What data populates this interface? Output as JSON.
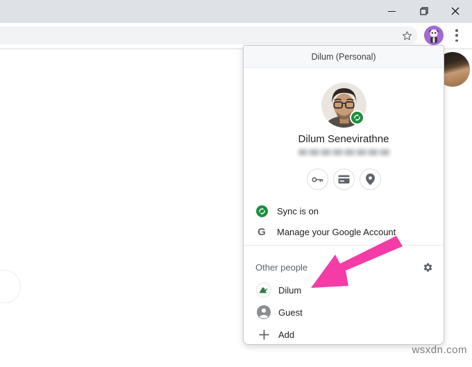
{
  "titlebar": {
    "controls": [
      {
        "icon": "minimize-icon"
      },
      {
        "icon": "maximize-restore-icon"
      },
      {
        "icon": "close-icon"
      }
    ]
  },
  "toolbar": {
    "bookmark_icon": "star-icon",
    "profile_button_icon": "panda-avatar",
    "menu_icon": "kebab-menu-icon"
  },
  "profile_menu": {
    "header": "Dilum (Personal)",
    "account": {
      "name": "Dilum Senevirathne",
      "email_obscured": true,
      "badge_icon": "sync-icon"
    },
    "shortcuts": [
      {
        "icon": "key-icon",
        "name": "passwords"
      },
      {
        "icon": "card-icon",
        "name": "payment-methods"
      },
      {
        "icon": "location-pin-icon",
        "name": "addresses"
      }
    ],
    "menu_items": [
      {
        "icon": "sync-on-icon",
        "label": "Sync is on"
      },
      {
        "icon": "google-g-icon",
        "glyph": "G",
        "label": "Manage your Google Account"
      }
    ],
    "other_people": {
      "title": "Other people",
      "settings_icon": "gear-icon",
      "items": [
        {
          "icon": "plant-avatar",
          "label": "Dilum"
        },
        {
          "icon": "guest-icon",
          "label": "Guest"
        },
        {
          "icon": "plus-icon",
          "label": "Add"
        }
      ]
    }
  },
  "annotation": {
    "type": "arrow",
    "color": "#f43ba6",
    "points_to": "Dilum"
  },
  "watermark": "wsxdn.com",
  "colors": {
    "titlebar": "#dee1e6",
    "omnibox": "#f1f3f4",
    "profile_accent": "#a569d2",
    "sync_green": "#1e8e3e",
    "arrow_pink": "#f43ba6"
  }
}
